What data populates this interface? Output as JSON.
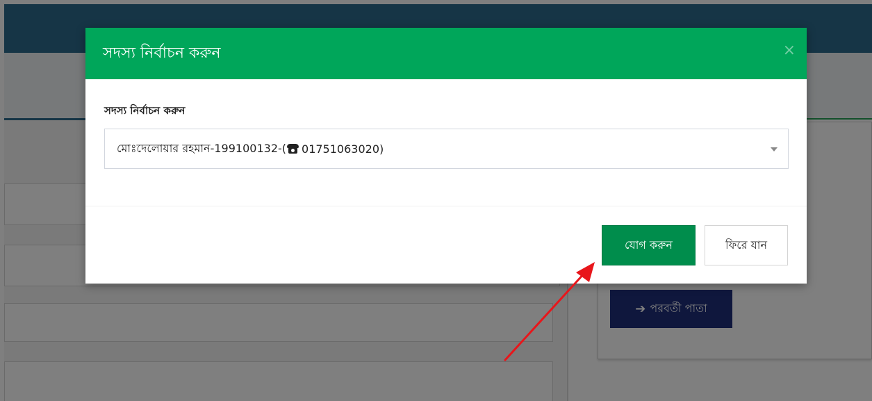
{
  "background": {
    "next_page_button": {
      "icon": "arrow-right-icon",
      "label": "পরবর্তী পাতা"
    }
  },
  "modal": {
    "title": "সদস্য নির্বাচন করুন",
    "close_icon": "close-icon",
    "close_glyph": "×",
    "member_select": {
      "label": "সদস্য নির্বাচন করুন",
      "selected_prefix": "মোঃদেলোয়ার রহমান-199100132-(",
      "phone_icon": "phone-icon",
      "selected_phone": " 01751063020)"
    },
    "buttons": {
      "add_label": "যোগ করুন",
      "back_label": "ফিরে যান"
    }
  },
  "colors": {
    "header_green": "#00a65a",
    "add_button_green": "#008d4c",
    "next_button_navy": "#1e2e7a",
    "annotation_red": "#e8161b"
  }
}
